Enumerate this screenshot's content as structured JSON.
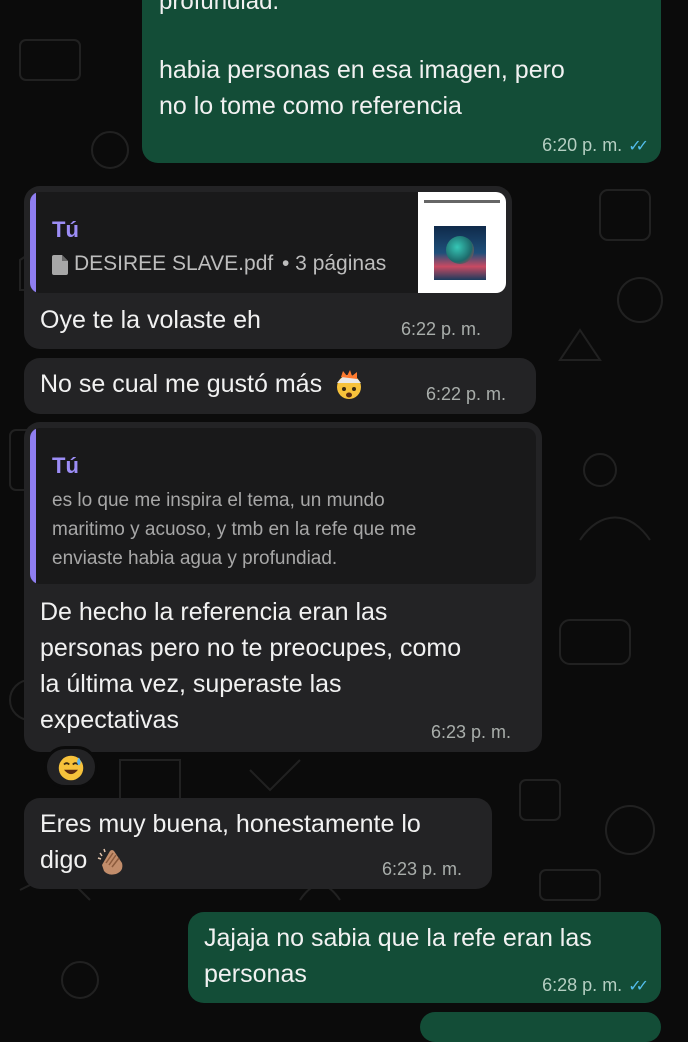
{
  "chat": {
    "msg1": {
      "text_top": "profundiad.",
      "text_line1": "habia personas en esa imagen, pero",
      "text_line2": "no lo tome como referencia",
      "time": "6:20 p. m.",
      "ticks": "✓✓"
    },
    "msg2": {
      "quote_author": "Tú",
      "file_icon": "document-icon",
      "file_name": "DESIREE SLAVE.pdf",
      "file_meta": "• 3 páginas",
      "text": "Oye te la volaste eh",
      "time": "6:22 p. m."
    },
    "msg3": {
      "text": "No se cual me gustó más",
      "emoji": "exploding-head-emoji",
      "time": "6:22 p. m."
    },
    "msg4": {
      "quote_author": "Tú",
      "quote_line1": "es lo que me inspira el tema, un mundo",
      "quote_line2": "maritimo y acuoso, y tmb en la refe que me",
      "quote_line3": "enviaste habia agua y profundiad.",
      "text_line1": "De hecho la referencia eran las",
      "text_line2": "personas pero no te preocupes, como",
      "text_line3": "la última vez, superaste las",
      "text_line4": "expectativas",
      "time": "6:23 p. m.",
      "reaction": "sweat-smile-emoji"
    },
    "msg5": {
      "text_line1": "Eres muy buena, honestamente lo",
      "text_line2": "digo",
      "emoji": "clapping-hands-emoji",
      "time": "6:23 p. m."
    },
    "msg6": {
      "text_line1": "Jajaja no sabia que la refe eran las",
      "text_line2": "personas",
      "time": "6:28 p. m.",
      "ticks": "✓✓"
    }
  },
  "colors": {
    "background": "#0b0b0b",
    "outgoing_bubble": "#134d37",
    "incoming_bubble": "#232325",
    "quote_accent": "#8f7ef0",
    "read_ticks": "#53bdeb"
  }
}
